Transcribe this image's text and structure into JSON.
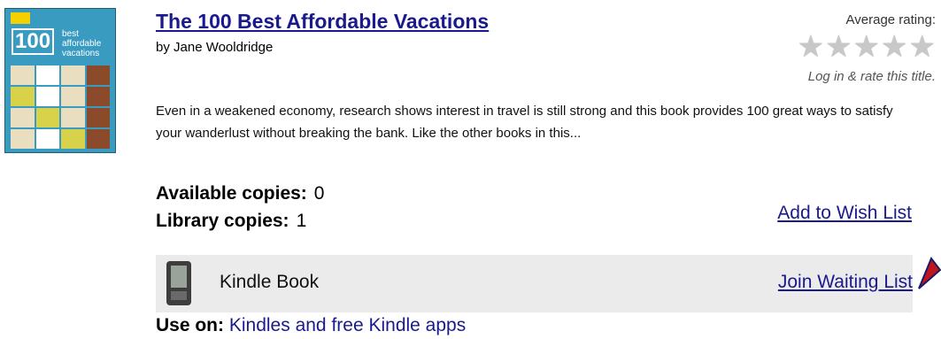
{
  "book": {
    "title": "The 100 Best Affordable Vacations",
    "author": "by Jane Wooldridge",
    "description": "Even in a weakened economy, research shows interest in travel is still strong and this book provides 100 great ways to satisfy your wanderlust without breaking the bank. Like the other books in this...",
    "cover": {
      "number": "100",
      "subtitle": "best affordable vacations"
    }
  },
  "rating": {
    "label": "Average rating:",
    "value": 0,
    "max": 5,
    "rate_link": "Log in & rate this title."
  },
  "copies": {
    "available_label": "Available copies:",
    "available_value": "0",
    "library_label": "Library copies:",
    "library_value": "1"
  },
  "actions": {
    "wish_list": "Add to Wish List",
    "waiting_list": "Join Waiting List"
  },
  "format": {
    "name": "Kindle Book",
    "use_on_label": "Use on:",
    "use_on_value": "Kindles and free Kindle apps"
  },
  "colors": {
    "link": "#1a1a8c",
    "format_bar": "#ebebeb",
    "cover": "#3a9bc0",
    "arrow": "#c0161b"
  }
}
